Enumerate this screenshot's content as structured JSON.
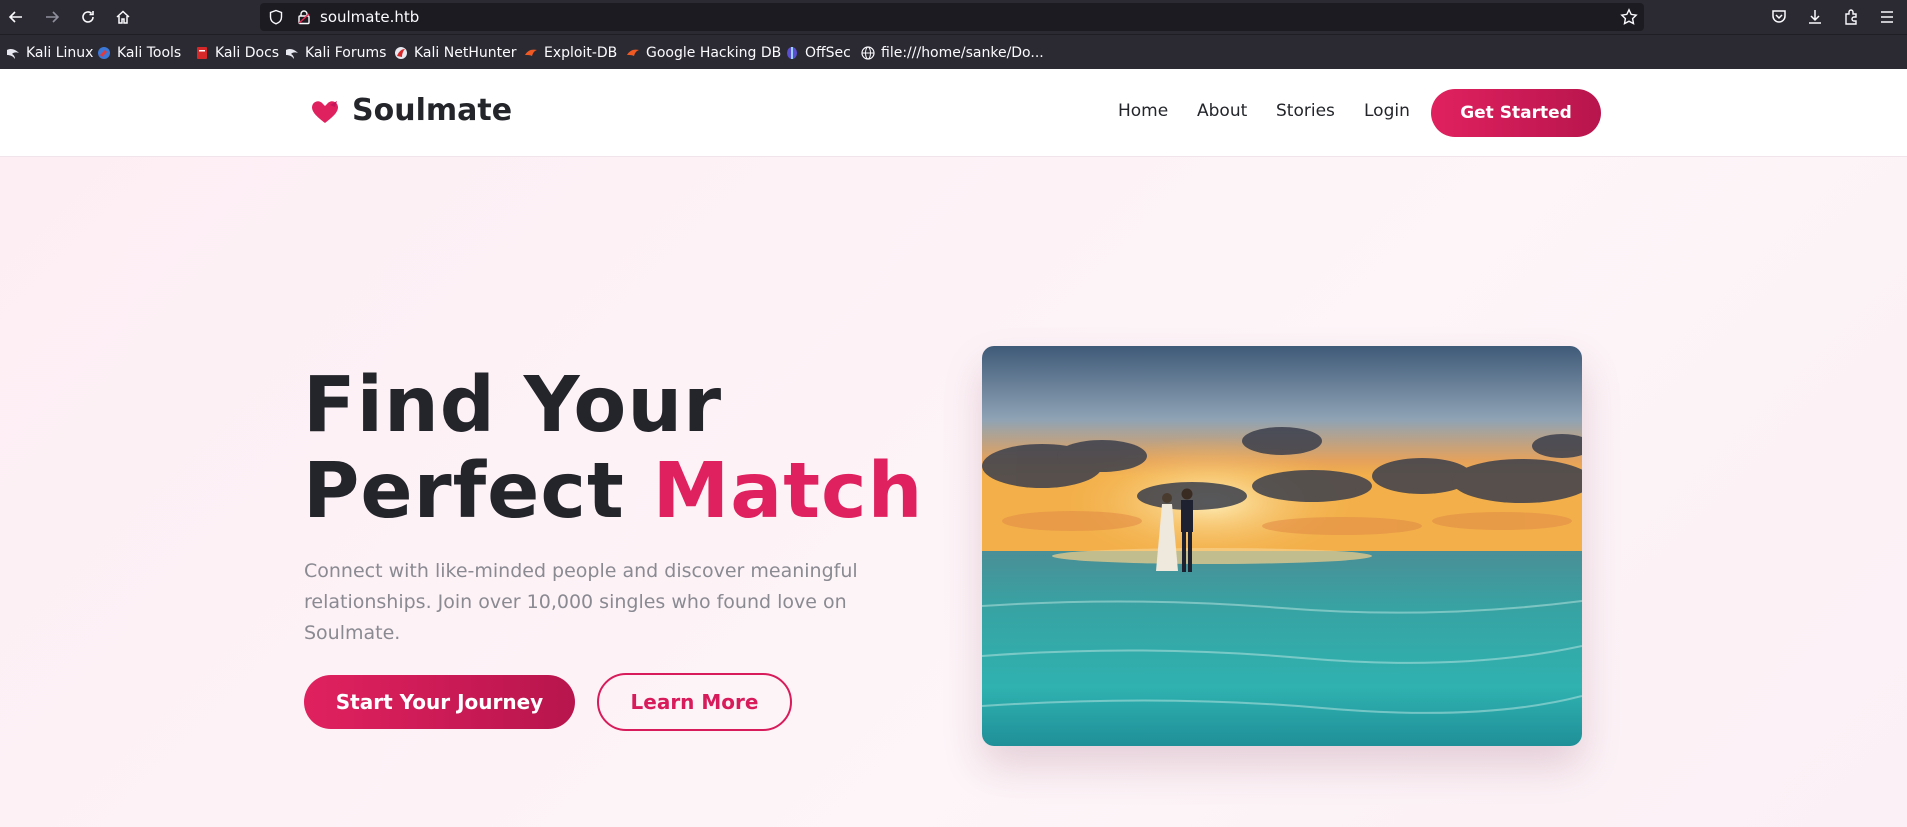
{
  "browser": {
    "url": "soulmate.htb",
    "bookmarks": [
      {
        "label": "Kali Linux",
        "icon": "kali-dragon-icon"
      },
      {
        "label": "Kali Tools",
        "icon": "kali-tools-icon"
      },
      {
        "label": "Kali Docs",
        "icon": "kali-docs-icon"
      },
      {
        "label": "Kali Forums",
        "icon": "kali-dragon-icon"
      },
      {
        "label": "Kali NetHunter",
        "icon": "nethunter-icon"
      },
      {
        "label": "Exploit-DB",
        "icon": "exploit-db-icon"
      },
      {
        "label": "Google Hacking DB",
        "icon": "ghdb-icon"
      },
      {
        "label": "OffSec",
        "icon": "offsec-icon"
      },
      {
        "label": "file:///home/sanke/Do...",
        "icon": "globe-icon"
      }
    ]
  },
  "site": {
    "brand": "Soulmate",
    "brand_color": "#e0215f",
    "nav": [
      "Home",
      "About",
      "Stories",
      "Login"
    ],
    "cta": "Get Started"
  },
  "hero": {
    "title_line1": "Find Your",
    "title_line2_prefix": "Perfect ",
    "title_line2_accent": "Match",
    "subtitle": "Connect with like-minded people and discover meaningful relationships. Join over 10,000 singles who found love on Soulmate.",
    "primary_button": "Start Your Journey",
    "secondary_button": "Learn More"
  }
}
